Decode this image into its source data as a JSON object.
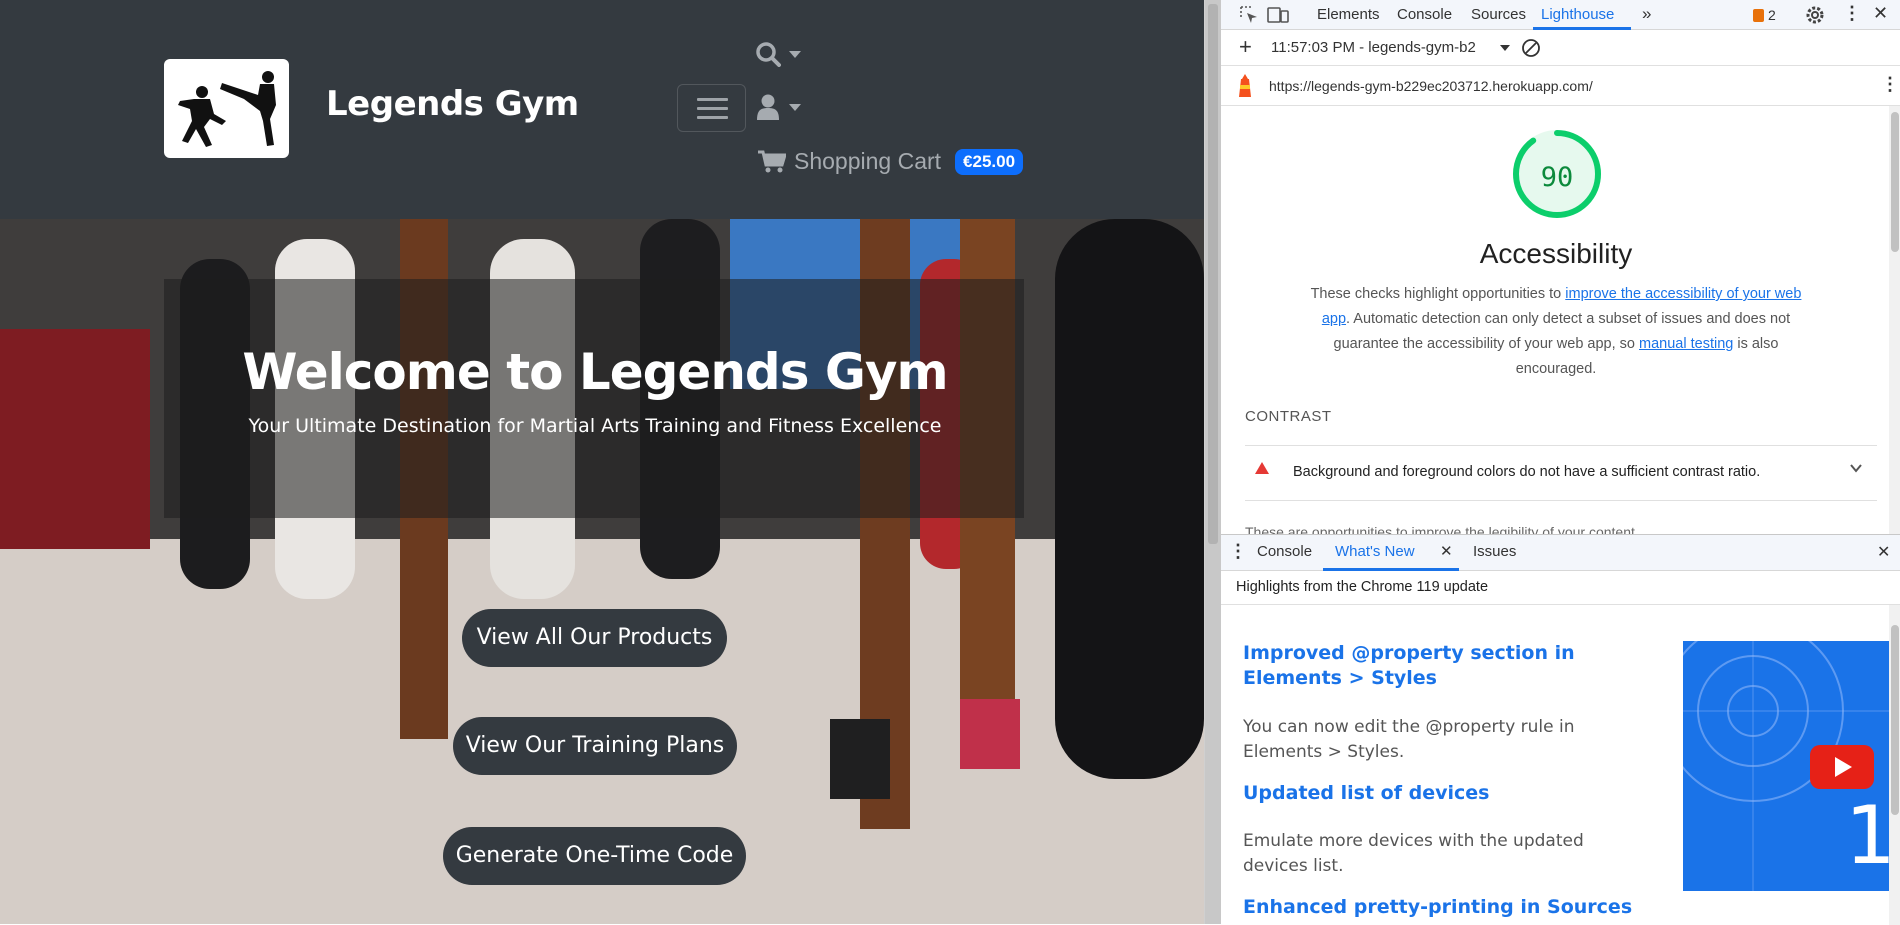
{
  "site": {
    "brand": "Legends Gym",
    "cart": {
      "label": "Shopping Cart",
      "total": "€25.00"
    },
    "hero": {
      "title": "Welcome to Legends Gym",
      "subtitle": "Your Ultimate Destination for Martial Arts Training and Fitness Excellence"
    },
    "buttons": {
      "products": "View All Our Products",
      "training": "View Our Training Plans",
      "code": "Generate One-Time Code"
    }
  },
  "devtools": {
    "tabs": [
      "Elements",
      "Console",
      "Sources",
      "Lighthouse"
    ],
    "active_tab": "Lighthouse",
    "issues_count": "2",
    "report_selector": "11:57:03 PM - legends-gym-b2",
    "url": "https://legends-gym-b229ec203712.herokuapp.com/",
    "lighthouse": {
      "score": 90,
      "category": "Accessibility",
      "desc_before": "These checks highlight opportunities to ",
      "desc_link1": "improve the accessibility of your web app",
      "desc_mid": ". Automatic detection can only detect a subset of issues and does not guarantee the accessibility of your web app, so ",
      "desc_link2": "manual testing",
      "desc_after": " is also encouraged.",
      "group": "CONTRAST",
      "audit": "Background and foreground colors do not have a sufficient contrast ratio.",
      "next_text": "These are opportunities to improve the legibility of your content."
    },
    "drawer": {
      "tabs": [
        "Console",
        "What's New",
        "Issues"
      ],
      "active_tab": "What's New",
      "header": "Highlights from the Chrome 119 update",
      "items": [
        {
          "title": "Improved @property section in Elements > Styles",
          "body": "You can now edit the @property rule in Elements > Styles."
        },
        {
          "title": "Updated list of devices",
          "body": "Emulate more devices with the updated devices list."
        },
        {
          "title": "Enhanced pretty-printing in Sources",
          "body": ""
        }
      ],
      "thumb_number": "1"
    },
    "colors": {
      "accent": "#1a73e8",
      "score_green": "#0cce6b",
      "fail_red": "#e53935"
    }
  }
}
